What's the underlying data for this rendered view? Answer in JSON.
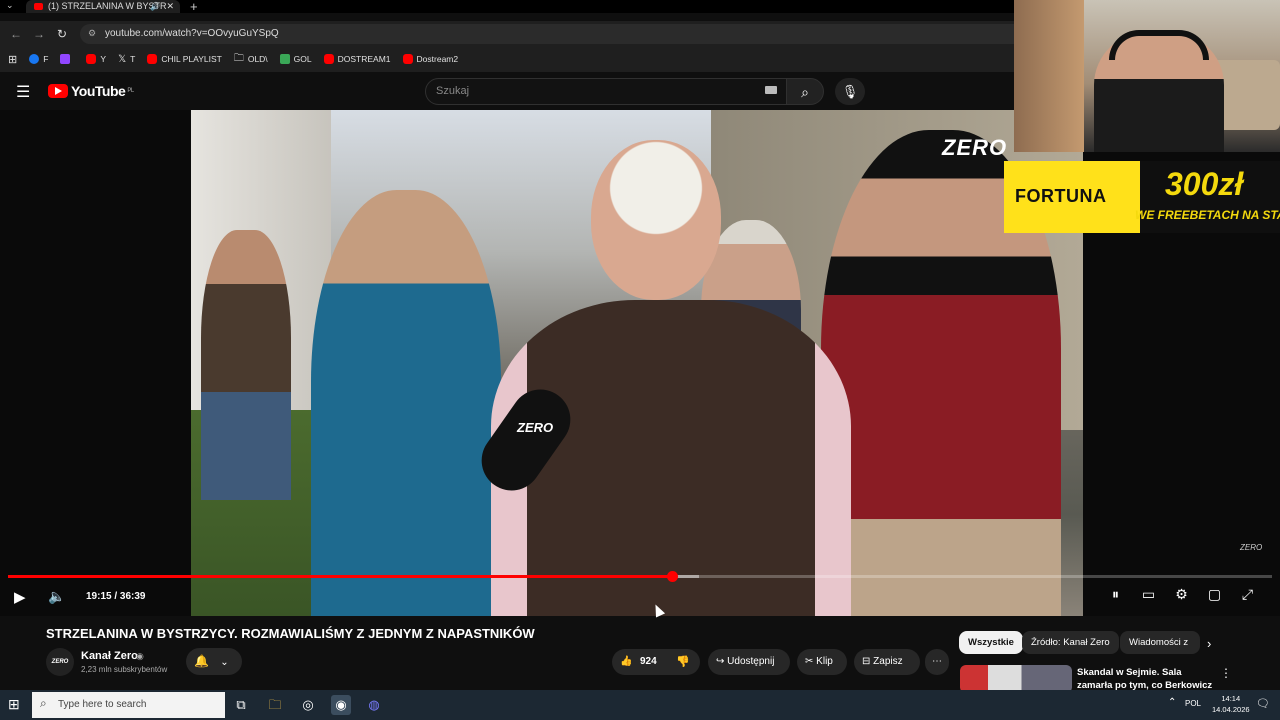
{
  "browser": {
    "tab_title": "(1) STRZELANINA W BYSTR",
    "new_tab": "+",
    "url": "youtube.com/watch?v=OOvyuGuYSpQ",
    "bookmarks": [
      {
        "label": "F",
        "color": "#1877f2"
      },
      {
        "label": "",
        "color": "#9146ff"
      },
      {
        "label": "Y",
        "color": "#ff0000"
      },
      {
        "label": "T",
        "color": "#000000"
      },
      {
        "label": "CHIL PLAYLIST",
        "color": "#ff0000"
      },
      {
        "label": "OLD\\",
        "color": "#777777"
      },
      {
        "label": "GOL",
        "color": "#3aa757"
      },
      {
        "label": "DOSTREAM1",
        "color": "#ff0000"
      },
      {
        "label": "Dostream2",
        "color": "#ff0000"
      }
    ]
  },
  "youtube": {
    "logo_text": "YouTube",
    "logo_region": "PL",
    "search_placeholder": "Szukaj"
  },
  "video": {
    "overlay_logo": "ZERO",
    "mic_label": "ZERO",
    "watermark": "ZERO",
    "time_display": "19:15 / 36:39",
    "progress_fraction": 0.525,
    "buffer_fraction": 0.547
  },
  "ad": {
    "brand": "FORTUNA",
    "amount": "300zł",
    "tagline": "WE FREEBETACH NA START",
    "color": "#f4d90d"
  },
  "details": {
    "title": "STRZELANINA W BYSTRZYCY. ROZMAWIALIŚMY Z JEDNYM Z NAPASTNIKÓW",
    "channel": "Kanał Zero",
    "avatar_text": "ZERO",
    "subscribers": "2,23 mln subskrybentów",
    "likes": "924",
    "share_label": "Udostępnij",
    "clip_label": "Klip",
    "save_label": "Zapisz"
  },
  "chips": {
    "all": "Wszystkie",
    "source": "Źródło: Kanał Zero",
    "news": "Wiadomości z"
  },
  "related": {
    "title": "Skandal w Sejmie. Sala zamarła po tym, co Berkowicz wyjął na ..."
  },
  "taskbar": {
    "search_placeholder": "Type here to search",
    "lang": "POL",
    "time": "14:14",
    "date": "14.04.2026"
  },
  "colors": {
    "youtube_red": "#ff0000",
    "background": "#0f0f0f"
  }
}
